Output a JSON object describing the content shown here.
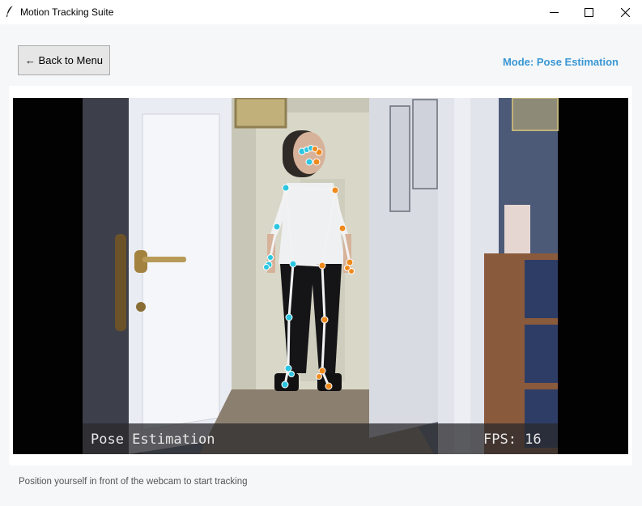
{
  "window": {
    "title": "Motion Tracking Suite",
    "icon": "feather-icon",
    "controls": [
      "minimize-icon",
      "maximize-icon",
      "close-icon"
    ]
  },
  "toolbar": {
    "back_label": "← Back to Menu",
    "mode_text": "Mode: Pose Estimation"
  },
  "video": {
    "mode_overlay": "Pose Estimation",
    "fps_text": "FPS: 16",
    "colors": {
      "left_joint": "#2cc6e0",
      "right_joint": "#ef8a1c",
      "skeleton": "#f2f2f2"
    }
  },
  "status": {
    "text": "Position yourself in front of the webcam to start tracking"
  }
}
